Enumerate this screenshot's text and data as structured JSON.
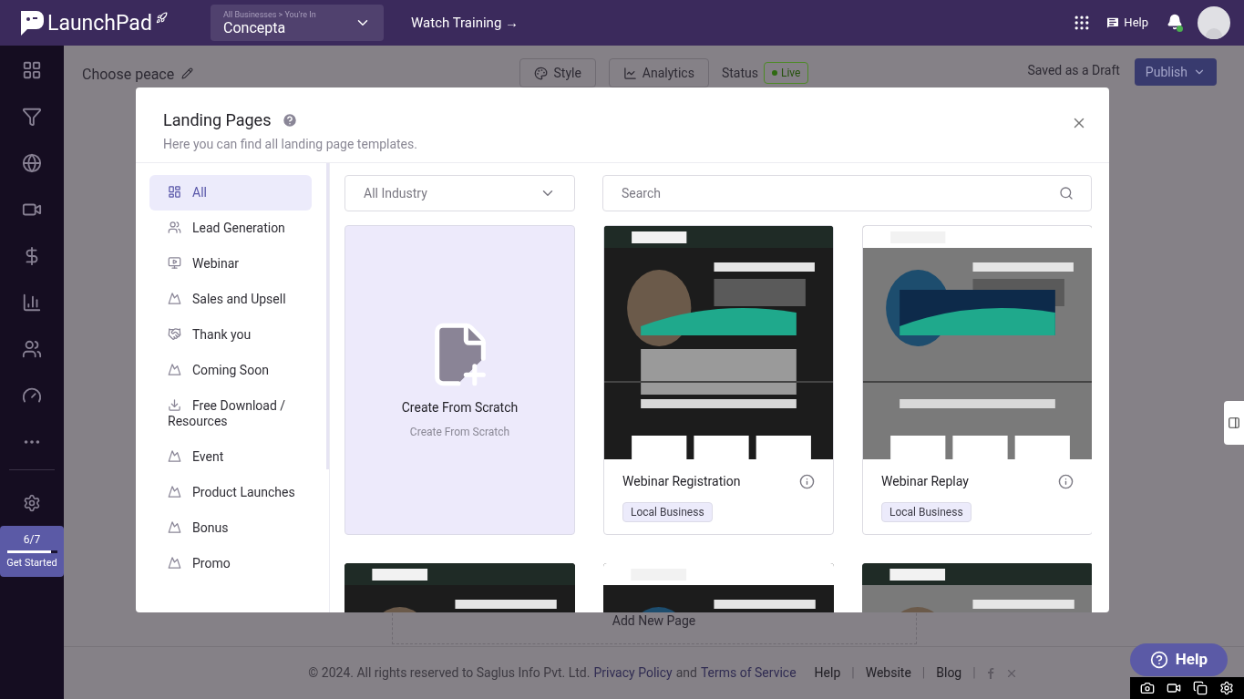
{
  "header": {
    "logo_text": "LaunchPad",
    "business_switcher": {
      "breadcrumb": "All Businesses > You're In",
      "name": "Concepta"
    },
    "training_link": "Watch Training →",
    "help": "Help",
    "notifications": {
      "unread": true
    }
  },
  "onboarding": {
    "progress": "6/7",
    "level": 0.88,
    "label": "Get Started"
  },
  "editor": {
    "title": "Choose peace",
    "tabs": [
      "Style",
      "Analytics"
    ],
    "status_label": "Status",
    "status": "Live",
    "save_state": "Saved as a Draft",
    "publish": "Publish",
    "add_page": "Add New Page"
  },
  "footer": {
    "copyright": "©  2024. All rights reserved to Saglus Info Pvt. Ltd.",
    "privacy": "Privacy Policy",
    "and": "and",
    "terms": "Terms of Service",
    "links": [
      "Help",
      "Website",
      "Blog"
    ],
    "separator": "|"
  },
  "help_fab": "Help",
  "modal": {
    "title": "Landing Pages",
    "subtitle": "Here you can find all landing page templates.",
    "categories": [
      {
        "label": "All",
        "kind": "all",
        "selected": true
      },
      {
        "label": "Lead Generation",
        "kind": "people",
        "selected": false
      },
      {
        "label": "Webinar",
        "kind": "monitor",
        "selected": false
      },
      {
        "label": "Sales and Upsell",
        "kind": "mountain",
        "selected": false
      },
      {
        "label": "Thank you",
        "kind": "handshake",
        "selected": false
      },
      {
        "label": "Coming Soon",
        "kind": "mountain",
        "selected": false
      },
      {
        "label": "Free Download / Resources",
        "kind": "download",
        "selected": false
      },
      {
        "label": "Event",
        "kind": "mountain",
        "selected": false
      },
      {
        "label": "Product Launches",
        "kind": "mountain",
        "selected": false
      },
      {
        "label": "Bonus",
        "kind": "mountain",
        "selected": false
      },
      {
        "label": "Promo",
        "kind": "mountain",
        "selected": false
      }
    ],
    "industry_filter": "All Industry",
    "search_placeholder": "Search",
    "scratch": {
      "title": "Create From Scratch",
      "subtitle": "Create From Scratch"
    },
    "templates": [
      {
        "preview": {
          "kind": "picture"
        },
        "name": "Webinar Registration",
        "tag": "Local Business"
      },
      {
        "preview": {
          "kind": "picture"
        },
        "name": "Webinar Replay",
        "tag": "Local Business"
      },
      {
        "preview": {
          "kind": "picture"
        }
      },
      {
        "preview": {
          "kind": "picture"
        }
      },
      {
        "preview": {
          "kind": "picture"
        }
      }
    ]
  }
}
